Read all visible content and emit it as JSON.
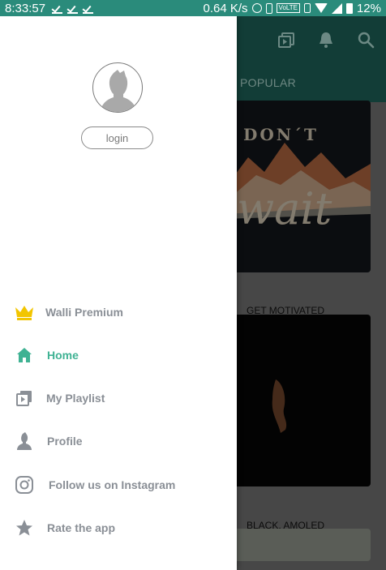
{
  "status_bar": {
    "time": "8:33:57",
    "speed": "0.64 K/s",
    "volte": "VoLTE",
    "battery": "12%"
  },
  "background": {
    "tab_label": "POPULAR",
    "cards": [
      {
        "label": "GET MOTIVATED",
        "art_text_top": "DON´T",
        "art_text_main": "wait"
      },
      {
        "label": "BLACK, AMOLED"
      }
    ]
  },
  "drawer": {
    "login_label": "login",
    "menu": [
      {
        "label": "Walli Premium",
        "icon": "crown-icon",
        "active": false
      },
      {
        "label": "Home",
        "icon": "home-icon",
        "active": true
      },
      {
        "label": "My Playlist",
        "icon": "playlist-icon",
        "active": false
      },
      {
        "label": "Profile",
        "icon": "profile-icon",
        "active": false
      },
      {
        "label": "Follow us on Instagram",
        "icon": "instagram-icon",
        "active": false
      },
      {
        "label": "Rate the app",
        "icon": "star-icon",
        "active": false
      }
    ]
  },
  "colors": {
    "accent": "#3fb293",
    "toolbar": "#2a8b7b",
    "premium": "#f2c500",
    "menu_text": "#8a8f96"
  }
}
